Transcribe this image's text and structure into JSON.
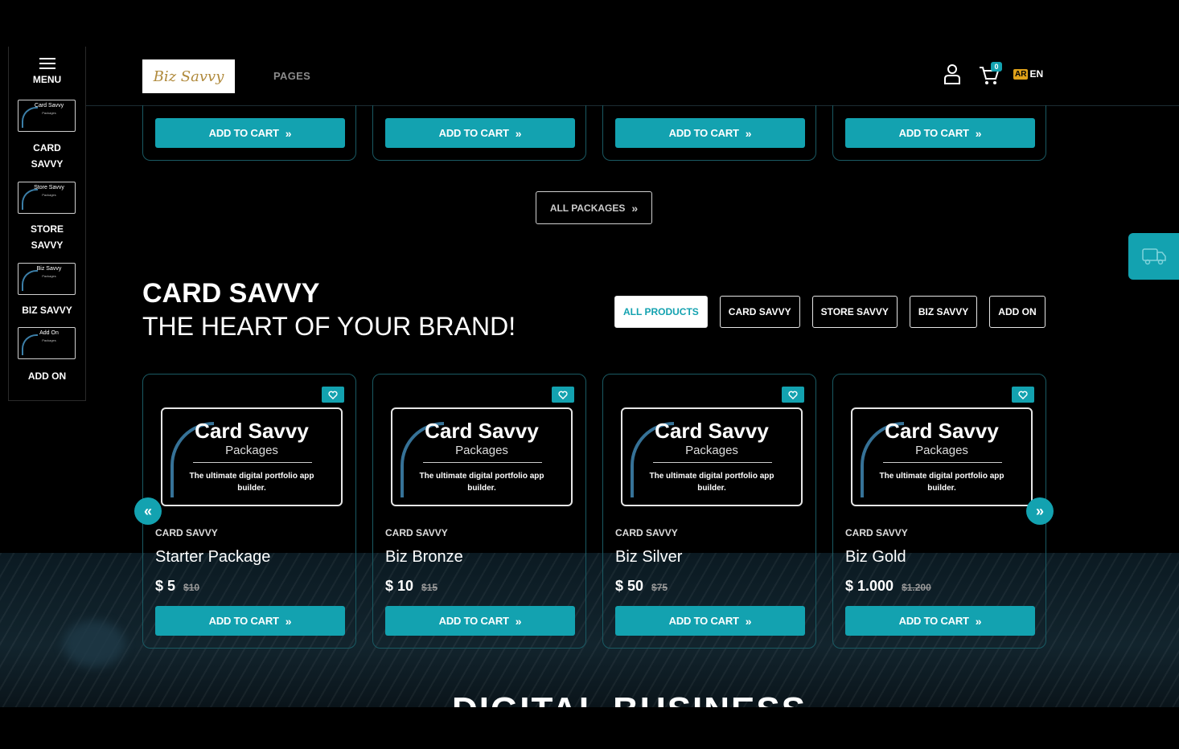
{
  "header": {
    "logo_text": "Biz Savvy",
    "pages_label": "PAGES",
    "cart_count": "0",
    "lang_ar": "AR",
    "lang_en": "EN"
  },
  "sidemenu": {
    "menu_label": "MENU",
    "items": [
      {
        "thumb_title": "Card Savvy",
        "thumb_sub": "Packages",
        "label_line1": "CARD",
        "label_line2": "SAVVY"
      },
      {
        "thumb_title": "Store Savvy",
        "thumb_sub": "Packages",
        "label_line1": "STORE",
        "label_line2": "SAVVY"
      },
      {
        "thumb_title": "Biz Savvy",
        "thumb_sub": "Packages",
        "label_line1": "BIZ SAVVY",
        "label_line2": ""
      },
      {
        "thumb_title": "Add On",
        "thumb_sub": "Packages",
        "label_line1": "ADD ON",
        "label_line2": ""
      }
    ]
  },
  "top_row": {
    "add_to_cart": "ADD TO CART"
  },
  "all_packages": "ALL PACKAGES",
  "section": {
    "title": "CARD SAVVY",
    "subtitle": "THE HEART OF YOUR BRAND!",
    "filters": [
      "ALL PRODUCTS",
      "CARD SAVVY",
      "STORE SAVVY",
      "BIZ SAVVY",
      "ADD ON"
    ]
  },
  "products": [
    {
      "thumb_title": "Card Savvy",
      "thumb_sub": "Packages",
      "thumb_desc": "The ultimate digital portfolio app builder.",
      "category": "CARD SAVVY",
      "name": "Starter Package",
      "price": "$ 5",
      "old_price": "$10",
      "button": "ADD TO CART"
    },
    {
      "thumb_title": "Card Savvy",
      "thumb_sub": "Packages",
      "thumb_desc": "The ultimate digital portfolio app builder.",
      "category": "CARD SAVVY",
      "name": "Biz Bronze",
      "price": "$ 10",
      "old_price": "$15",
      "button": "ADD TO CART"
    },
    {
      "thumb_title": "Card Savvy",
      "thumb_sub": "Packages",
      "thumb_desc": "The ultimate digital portfolio app builder.",
      "category": "CARD SAVVY",
      "name": "Biz Silver",
      "price": "$ 50",
      "old_price": "$75",
      "button": "ADD TO CART"
    },
    {
      "thumb_title": "Card Savvy",
      "thumb_sub": "Packages",
      "thumb_desc": "The ultimate digital portfolio app builder.",
      "category": "CARD SAVVY",
      "name": "Biz Gold",
      "price": "$ 1.000",
      "old_price": "$1.200",
      "button": "ADD TO CART"
    }
  ],
  "next_section_title": "DIGITAL BUSINESS",
  "colors": {
    "accent": "#13a2b0",
    "background": "#000000",
    "border": "#1a5a63"
  }
}
